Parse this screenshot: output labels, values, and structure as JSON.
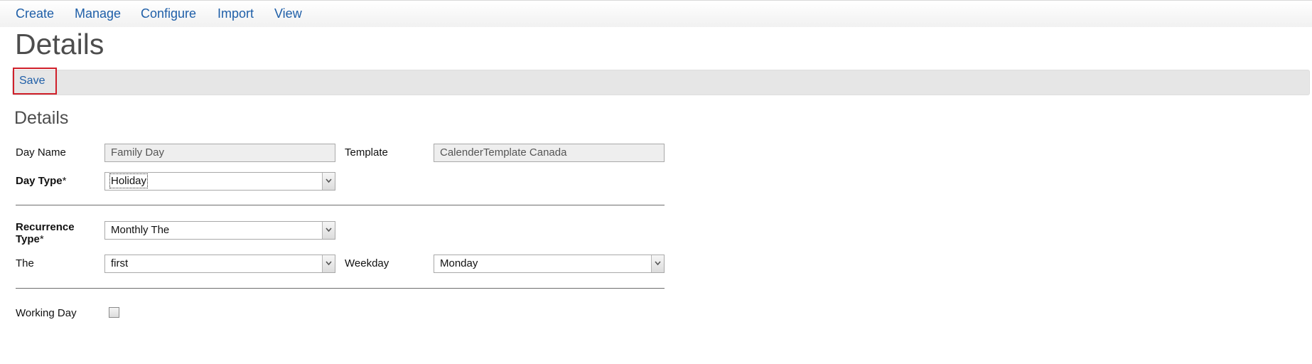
{
  "nav": {
    "items": [
      {
        "label": "Create"
      },
      {
        "label": "Manage"
      },
      {
        "label": "Configure"
      },
      {
        "label": "Import"
      },
      {
        "label": "View"
      }
    ]
  },
  "page": {
    "title": "Details"
  },
  "toolbar": {
    "save_label": "Save"
  },
  "form": {
    "section_title": "Details",
    "day_name": {
      "label": "Day Name",
      "value": "Family Day"
    },
    "template": {
      "label": "Template",
      "value": "CalenderTemplate Canada"
    },
    "day_type": {
      "label": "Day Type",
      "required": "*",
      "value": "Holiday"
    },
    "recurrence_type": {
      "label_line1": "Recurrence",
      "label_line2": "Type",
      "required": "*",
      "value": "Monthly The"
    },
    "the": {
      "label": "The",
      "value": "first"
    },
    "weekday": {
      "label": "Weekday",
      "value": "Monday"
    },
    "working_day": {
      "label": "Working Day",
      "checked": false
    }
  },
  "colors": {
    "link": "#1f5fa8",
    "save_highlight": "#d0202a",
    "toolbar_bg": "#e6e6e6"
  }
}
